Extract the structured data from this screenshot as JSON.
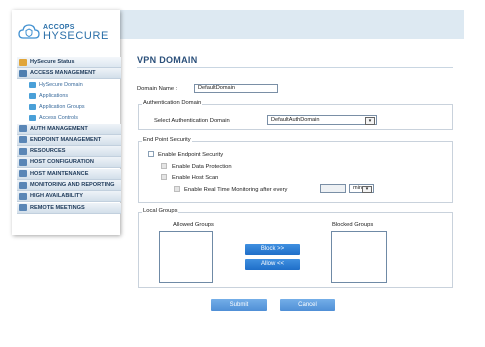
{
  "brand": {
    "line1": "ACCOPS",
    "line2": "HYSECURE"
  },
  "sidebar": {
    "items": [
      {
        "label": "HySecure Status",
        "icon": "status-icon",
        "color": "#e0a53a"
      },
      {
        "label": "ACCESS MANAGEMENT",
        "icon": "access-management-icon",
        "color": "#4f7fb0"
      },
      {
        "label": "HySecure Domain",
        "icon": "domain-icon",
        "color": "#4aa0d8"
      },
      {
        "label": "Applications",
        "icon": "applications-icon",
        "color": "#4aa0d8"
      },
      {
        "label": "Application Groups",
        "icon": "application-groups-icon",
        "color": "#4aa0d8"
      },
      {
        "label": "Access Controls",
        "icon": "access-controls-icon",
        "color": "#4aa0d8"
      },
      {
        "label": "AUTH MANAGEMENT",
        "icon": "auth-icon",
        "color": "#5a86b6"
      },
      {
        "label": "ENDPOINT MANAGEMENT",
        "icon": "endpoint-icon",
        "color": "#5a86b6"
      },
      {
        "label": "RESOURCES",
        "icon": "resources-icon",
        "color": "#5a86b6"
      },
      {
        "label": "HOST CONFIGURATION",
        "icon": "host-config-icon",
        "color": "#5a86b6"
      },
      {
        "label": "HOST MAINTENANCE",
        "icon": "host-maintenance-icon",
        "color": "#5a86b6"
      },
      {
        "label": "MONITORING AND REPORTING",
        "icon": "monitoring-icon",
        "color": "#5a86b6"
      },
      {
        "label": "HIGH AVAILABILITY",
        "icon": "high-availability-icon",
        "color": "#5a86b6"
      },
      {
        "label": "REMOTE MEETINGS",
        "icon": "remote-meetings-icon",
        "color": "#5a86b6"
      }
    ]
  },
  "main": {
    "title": "VPN DOMAIN",
    "domain_name_label": "Domain Name :",
    "domain_name_value": "DefaultDomain",
    "auth_section": {
      "legend": "Authentication Domain",
      "select_label": "Select Authentication Domain",
      "select_value": "DefaultAuthDomain"
    },
    "endpoint_section": {
      "legend": "End Point Security",
      "enable_label": "Enable Endpoint Security",
      "data_protection_label": "Enable Data Protection",
      "host_scan_label": "Enable Host Scan",
      "realtime_label": "Enable Real Time Monitoring after every",
      "interval_value": "",
      "unit_value": "min"
    },
    "local_groups": {
      "legend": "Local Groups",
      "allowed_label": "Allowed Groups",
      "blocked_label": "Blocked Groups",
      "block_button": "Block >>",
      "allow_button": "Allow <<"
    },
    "submit_button": "Submit",
    "cancel_button": "Cancel"
  },
  "colors": {
    "accent": "#2a6fa8",
    "button": "#1f6ec8",
    "title": "#2a4f7a"
  }
}
